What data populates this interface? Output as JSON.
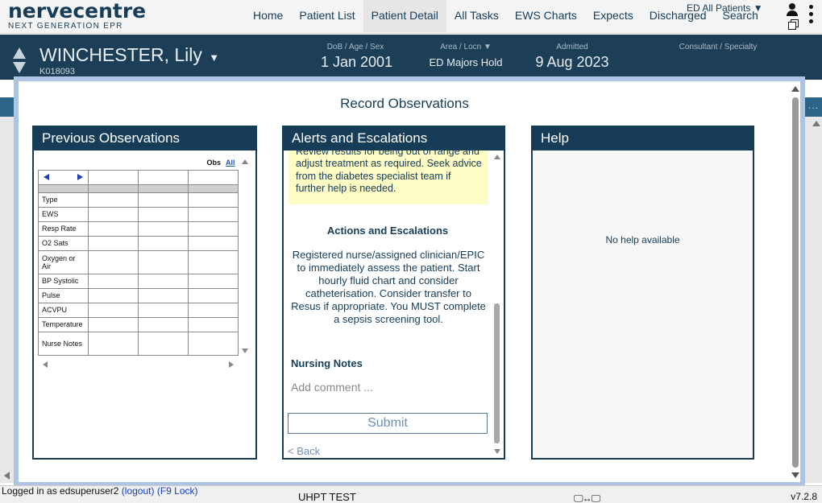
{
  "app": {
    "logo_main": "nervecentre",
    "logo_sub": "NEXT GENERATION EPR"
  },
  "nav": {
    "items": [
      {
        "label": "Home"
      },
      {
        "label": "Patient List"
      },
      {
        "label": "Patient Detail",
        "active": true
      },
      {
        "label": "All Tasks"
      },
      {
        "label": "EWS Charts"
      },
      {
        "label": "Expects"
      },
      {
        "label": "Discharged"
      },
      {
        "label": "Search"
      }
    ],
    "patients_filter": "ED All Patients ▼"
  },
  "patient": {
    "name": "WINCHESTER, Lily",
    "name_caret": "▼",
    "id": "K018093",
    "dob_label": "DoB / Age / Sex",
    "dob_value": "1 Jan 2001",
    "area_label": "Area / Locn  ▼",
    "area_value": "ED Majors Hold",
    "admitted_label": "Admitted",
    "admitted_value": "9 Aug 2023",
    "consultant_label": "Consultant / Specialty"
  },
  "background": {
    "dots": "..."
  },
  "modal": {
    "title": "Record Observations",
    "previous_observations": {
      "title": "Previous Observations",
      "obs_label": "Obs",
      "all_link": "All",
      "rows": [
        "Type",
        "EWS",
        "Resp Rate",
        "O2 Sats",
        "Oxygen or Air",
        "BP Systolic",
        "Pulse",
        "ACVPU",
        "Temperature",
        "Nurse Notes"
      ]
    },
    "alerts": {
      "title": "Alerts and Escalations",
      "alert_text": "Review results for being out of range and adjust treatment as required. Seek advice from the diabetes specialist team if further help is needed.",
      "actions_title": "Actions and Escalations",
      "actions_text": "Registered nurse/assigned clinician/EPIC to immediately assess the patient. Start hourly fluid chart and consider catheterisation. Consider transfer to Resus if appropriate. You MUST complete a sepsis screening tool.",
      "nursing_notes_title": "Nursing Notes",
      "comment_placeholder": "Add comment ...",
      "comment_value": "",
      "submit_label": "Submit",
      "back_label": "< Back"
    },
    "help": {
      "title": "Help",
      "text": "No help available"
    }
  },
  "footer": {
    "logged_in_text": "Logged in as edsuperuser2",
    "logout_link": "(logout)",
    "lock_link": "(F9 Lock)",
    "environment": "UHPT TEST",
    "screen_icon": "🖵↔🖵",
    "version": "v7.2.8"
  },
  "colors": {
    "brand_navy": "#163c58",
    "banner": "#1d3e57",
    "modal_border": "#aec4e4",
    "alert_yellow": "#fdfcc4",
    "link_blue": "#1a3fb8"
  }
}
